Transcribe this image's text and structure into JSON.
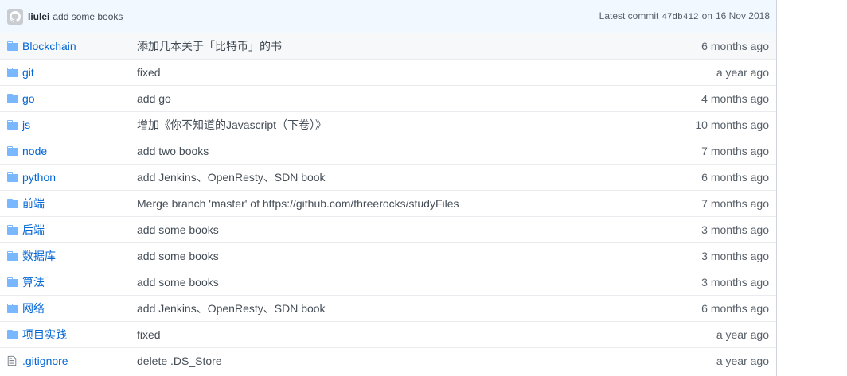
{
  "commit": {
    "author": "liulei",
    "message": "add some books",
    "prefix": "Latest commit",
    "sha": "47db412",
    "date_prefix": "on",
    "date": "16 Nov 2018"
  },
  "icons": {
    "folder_color": "#79b8ff",
    "file_color": "#6a737d",
    "link_color": "#0366d6"
  },
  "files": [
    {
      "type": "folder",
      "name": "Blockchain",
      "message": "添加几本关于「比特币」的书",
      "age": "6 months ago"
    },
    {
      "type": "folder",
      "name": "git",
      "message": "fixed",
      "age": "a year ago"
    },
    {
      "type": "folder",
      "name": "go",
      "message": "add go",
      "age": "4 months ago"
    },
    {
      "type": "folder",
      "name": "js",
      "message": "增加《你不知道的Javascript（下卷）》",
      "age": "10 months ago"
    },
    {
      "type": "folder",
      "name": "node",
      "message": "add two books",
      "age": "7 months ago"
    },
    {
      "type": "folder",
      "name": "python",
      "message": "add Jenkins、OpenResty、SDN book",
      "age": "6 months ago"
    },
    {
      "type": "folder",
      "name": "前端",
      "message": "Merge branch 'master' of https://github.com/threerocks/studyFiles",
      "age": "7 months ago"
    },
    {
      "type": "folder",
      "name": "后端",
      "message": "add some books",
      "age": "3 months ago"
    },
    {
      "type": "folder",
      "name": "数据库",
      "message": "add some books",
      "age": "3 months ago"
    },
    {
      "type": "folder",
      "name": "算法",
      "message": "add some books",
      "age": "3 months ago"
    },
    {
      "type": "folder",
      "name": "网络",
      "message": "add Jenkins、OpenResty、SDN book",
      "age": "6 months ago"
    },
    {
      "type": "folder",
      "name": "项目实践",
      "message": "fixed",
      "age": "a year ago"
    },
    {
      "type": "file",
      "name": ".gitignore",
      "message": "delete .DS_Store",
      "age": "a year ago"
    }
  ]
}
